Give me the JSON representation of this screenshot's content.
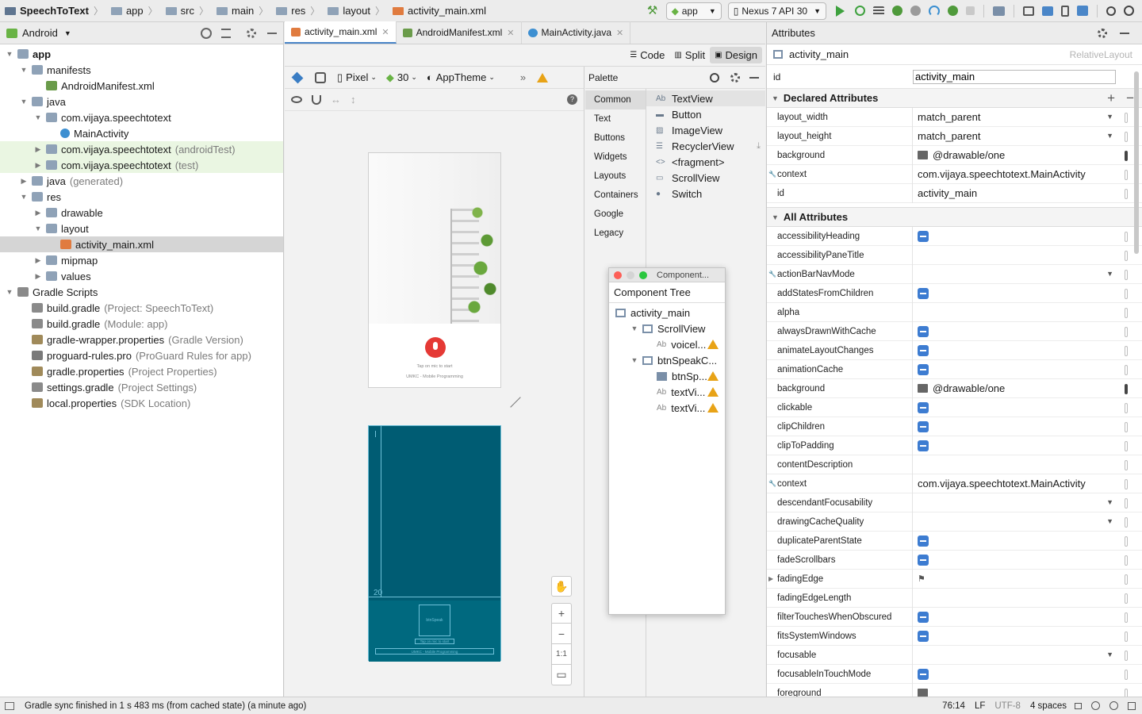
{
  "breadcrumb": [
    "SpeechToText",
    "app",
    "src",
    "main",
    "res",
    "layout",
    "activity_main.xml"
  ],
  "toolbar": {
    "run_config": "app",
    "device": "Nexus 7 API 30"
  },
  "project": {
    "view_mode": "Android",
    "tree": [
      {
        "label": "app",
        "depth": 0,
        "icon": "folder",
        "bold": true
      },
      {
        "label": "manifests",
        "depth": 1,
        "icon": "folder"
      },
      {
        "label": "AndroidManifest.xml",
        "depth": 2,
        "icon": "manifest",
        "leaf": true
      },
      {
        "label": "java",
        "depth": 1,
        "icon": "folder"
      },
      {
        "label": "com.vijaya.speechtotext",
        "depth": 2,
        "icon": "package"
      },
      {
        "label": "MainActivity",
        "depth": 3,
        "icon": "class",
        "leaf": true
      },
      {
        "label": "com.vijaya.speechtotext",
        "depth": 2,
        "icon": "package",
        "secondary": "(androidTest)",
        "tint": true,
        "collapsed": true
      },
      {
        "label": "com.vijaya.speechtotext",
        "depth": 2,
        "icon": "package",
        "secondary": "(test)",
        "tint": true,
        "collapsed": true
      },
      {
        "label": "java",
        "depth": 1,
        "icon": "folder",
        "secondary": "(generated)",
        "collapsed": true
      },
      {
        "label": "res",
        "depth": 1,
        "icon": "folder"
      },
      {
        "label": "drawable",
        "depth": 2,
        "icon": "folder",
        "collapsed": true
      },
      {
        "label": "layout",
        "depth": 2,
        "icon": "folder"
      },
      {
        "label": "activity_main.xml",
        "depth": 3,
        "icon": "layout",
        "leaf": true,
        "selected": true
      },
      {
        "label": "mipmap",
        "depth": 2,
        "icon": "folder",
        "collapsed": true
      },
      {
        "label": "values",
        "depth": 2,
        "icon": "folder",
        "collapsed": true
      },
      {
        "label": "Gradle Scripts",
        "depth": 0,
        "icon": "gradle"
      },
      {
        "label": "build.gradle",
        "depth": 1,
        "icon": "gradle",
        "secondary": "(Project: SpeechToText)",
        "leaf": true
      },
      {
        "label": "build.gradle",
        "depth": 1,
        "icon": "gradle",
        "secondary": "(Module: app)",
        "leaf": true
      },
      {
        "label": "gradle-wrapper.properties",
        "depth": 1,
        "icon": "props",
        "secondary": "(Gradle Version)",
        "leaf": true
      },
      {
        "label": "proguard-rules.pro",
        "depth": 1,
        "icon": "pro",
        "secondary": "(ProGuard Rules for app)",
        "leaf": true
      },
      {
        "label": "gradle.properties",
        "depth": 1,
        "icon": "props",
        "secondary": "(Project Properties)",
        "leaf": true
      },
      {
        "label": "settings.gradle",
        "depth": 1,
        "icon": "gradle",
        "secondary": "(Project Settings)",
        "leaf": true
      },
      {
        "label": "local.properties",
        "depth": 1,
        "icon": "props",
        "secondary": "(SDK Location)",
        "leaf": true
      }
    ]
  },
  "tabs": [
    {
      "label": "activity_main.xml",
      "active": true
    },
    {
      "label": "AndroidManifest.xml"
    },
    {
      "label": "MainActivity.java"
    }
  ],
  "view_modes": {
    "code": "Code",
    "split": "Split",
    "design": "Design"
  },
  "design_toolbar": {
    "device": "Pixel",
    "api": "30",
    "theme": "AppTheme"
  },
  "palette": {
    "title": "Palette",
    "categories": [
      "Common",
      "Text",
      "Buttons",
      "Widgets",
      "Layouts",
      "Containers",
      "Google",
      "Legacy"
    ],
    "items": [
      {
        "label": "TextView",
        "icon": "Ab"
      },
      {
        "label": "Button",
        "icon": "▬"
      },
      {
        "label": "ImageView",
        "icon": "▨"
      },
      {
        "label": "RecyclerView",
        "icon": "☰"
      },
      {
        "label": "<fragment>",
        "icon": "<>"
      },
      {
        "label": "ScrollView",
        "icon": "▭"
      },
      {
        "label": "Switch",
        "icon": "●"
      }
    ]
  },
  "component_tree": {
    "window_title": "Component...",
    "title": "Component Tree",
    "rows": [
      {
        "label": "activity_main",
        "depth": 0,
        "icon": "layout"
      },
      {
        "label": "ScrollView",
        "depth": 1,
        "icon": "scroll",
        "expanded": true
      },
      {
        "label": "voicel...",
        "depth": 2,
        "icon": "Ab",
        "warn": true
      },
      {
        "label": "btnSpeakC...",
        "depth": 1,
        "icon": "layout",
        "expanded": true
      },
      {
        "label": "btnSp...",
        "depth": 2,
        "icon": "img",
        "warn": true
      },
      {
        "label": "textVi...",
        "depth": 2,
        "icon": "Ab",
        "warn": true
      },
      {
        "label": "textVi...",
        "depth": 2,
        "icon": "Ab",
        "warn": true
      }
    ]
  },
  "preview": {
    "hint": "Tap on mic to start",
    "footer": "UMKC - Mobile Programming",
    "blueprint_button": "btnSpeak",
    "blueprint_hint": "Tap on mic to start",
    "blueprint_footer": "UMKC - Mobile Programming",
    "blueprint_guide": "20"
  },
  "zoom": {
    "fit": "1:1"
  },
  "attributes": {
    "title": "Attributes",
    "component": "activity_main",
    "component_type": "RelativeLayout",
    "id_label": "id",
    "id_value": "activity_main",
    "declared_title": "Declared Attributes",
    "declared": [
      {
        "k": "layout_width",
        "v": "match_parent",
        "dropdown": true
      },
      {
        "k": "layout_height",
        "v": "match_parent",
        "dropdown": true
      },
      {
        "k": "background",
        "v": "@drawable/one",
        "img": true
      },
      {
        "k": "context",
        "v": "com.vijaya.speechtotext.MainActivity",
        "wrench": true
      },
      {
        "k": "id",
        "v": "activity_main"
      }
    ],
    "all_title": "All Attributes",
    "all": [
      {
        "k": "accessibilityHeading",
        "chk": true
      },
      {
        "k": "accessibilityPaneTitle"
      },
      {
        "k": "actionBarNavMode",
        "wrench": true,
        "dropdown": true
      },
      {
        "k": "addStatesFromChildren",
        "chk": true
      },
      {
        "k": "alpha"
      },
      {
        "k": "alwaysDrawnWithCache",
        "chk": true
      },
      {
        "k": "animateLayoutChanges",
        "chk": true
      },
      {
        "k": "animationCache",
        "chk": true
      },
      {
        "k": "background",
        "v": "@drawable/one",
        "img": true
      },
      {
        "k": "clickable",
        "chk": true
      },
      {
        "k": "clipChildren",
        "chk": true
      },
      {
        "k": "clipToPadding",
        "chk": true
      },
      {
        "k": "contentDescription"
      },
      {
        "k": "context",
        "v": "com.vijaya.speechtotext.MainActivity",
        "wrench": true
      },
      {
        "k": "descendantFocusability",
        "dropdown": true
      },
      {
        "k": "drawingCacheQuality",
        "dropdown": true
      },
      {
        "k": "duplicateParentState",
        "chk": true
      },
      {
        "k": "fadeScrollbars",
        "chk": true
      },
      {
        "k": "fadingEdge",
        "flag": true,
        "expand": true
      },
      {
        "k": "fadingEdgeLength"
      },
      {
        "k": "filterTouchesWhenObscured",
        "chk": true
      },
      {
        "k": "fitsSystemWindows",
        "chk": true
      },
      {
        "k": "focusable",
        "dropdown": true
      },
      {
        "k": "focusableInTouchMode",
        "chk": true
      },
      {
        "k": "foreground",
        "img": true
      }
    ]
  },
  "status": {
    "message": "Gradle sync finished in 1 s 483 ms (from cached state) (a minute ago)",
    "position": "76:14",
    "line_sep": "LF",
    "encoding": "UTF-8",
    "indent": "4 spaces"
  },
  "colors": {
    "accent": "#4a86c8",
    "blueprint": "#005c73",
    "mic": "#e53935",
    "warning": "#e8a317",
    "selection": "#d5d5d5",
    "tint_row": "#eaf6e2"
  }
}
